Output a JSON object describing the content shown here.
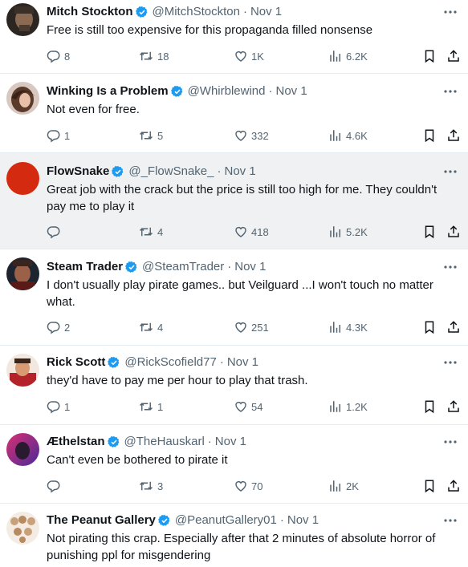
{
  "tweets": [
    {
      "name": "Mitch Stockton",
      "handle": "@MitchStockton",
      "date": "Nov 1",
      "text": "Free is still too expensive for this propaganda filled nonsense",
      "replies": "8",
      "retweets": "18",
      "likes": "1K",
      "views": "6.2K",
      "avatar_color": "#2b2622"
    },
    {
      "name": "Winking Is a Problem",
      "handle": "@Whirblewind",
      "date": "Nov 1",
      "text": "Not even for free.",
      "replies": "1",
      "retweets": "5",
      "likes": "332",
      "views": "4.6K",
      "avatar_color": "#6b4a3a"
    },
    {
      "name": "FlowSnake",
      "handle": "@_FlowSnake_",
      "date": "Nov 1",
      "text": "Great job with the crack but the price is still too high for me. They couldn't pay me to play it",
      "replies": "",
      "retweets": "4",
      "likes": "418",
      "views": "5.2K",
      "avatar_color": "#d42a10"
    },
    {
      "name": "Steam Trader",
      "handle": "@SteamTrader",
      "date": "Nov 1",
      "text": "I don't usually play pirate games.. but Veilguard ...I won't touch no matter what.",
      "replies": "2",
      "retweets": "4",
      "likes": "251",
      "views": "4.3K",
      "avatar_color": "#3a2420"
    },
    {
      "name": "Rick Scott",
      "handle": "@RickScofield77",
      "date": "Nov 1",
      "text": "they'd have to pay me per hour to play that trash.",
      "replies": "1",
      "retweets": "1",
      "likes": "54",
      "views": "1.2K",
      "avatar_color": "#b4232a"
    },
    {
      "name": "Æthelstan",
      "handle": "@TheHauskarl",
      "date": "Nov 1",
      "text": "Can't even be bothered to pirate it",
      "replies": "",
      "retweets": "3",
      "likes": "70",
      "views": "2K",
      "avatar_color": "#6a2a8a"
    },
    {
      "name": "The Peanut Gallery",
      "handle": "@PeanutGallery01",
      "date": "Nov 1",
      "text": "Not pirating this crap. Especially after that 2 minutes of absolute horror of punishing ppl for misgendering",
      "replies": "",
      "retweets": "",
      "likes": "",
      "views": "",
      "avatar_color": "#c8a07a"
    }
  ],
  "colors": {
    "verified": "#1d9bf0",
    "muted": "#536471",
    "highlight_bg": "#f0f1f2",
    "divider": "#e6ebef"
  },
  "icons": [
    "reply-icon",
    "retweet-icon",
    "like-icon",
    "views-icon",
    "bookmark-icon",
    "share-icon",
    "more-icon",
    "verified-icon"
  ]
}
